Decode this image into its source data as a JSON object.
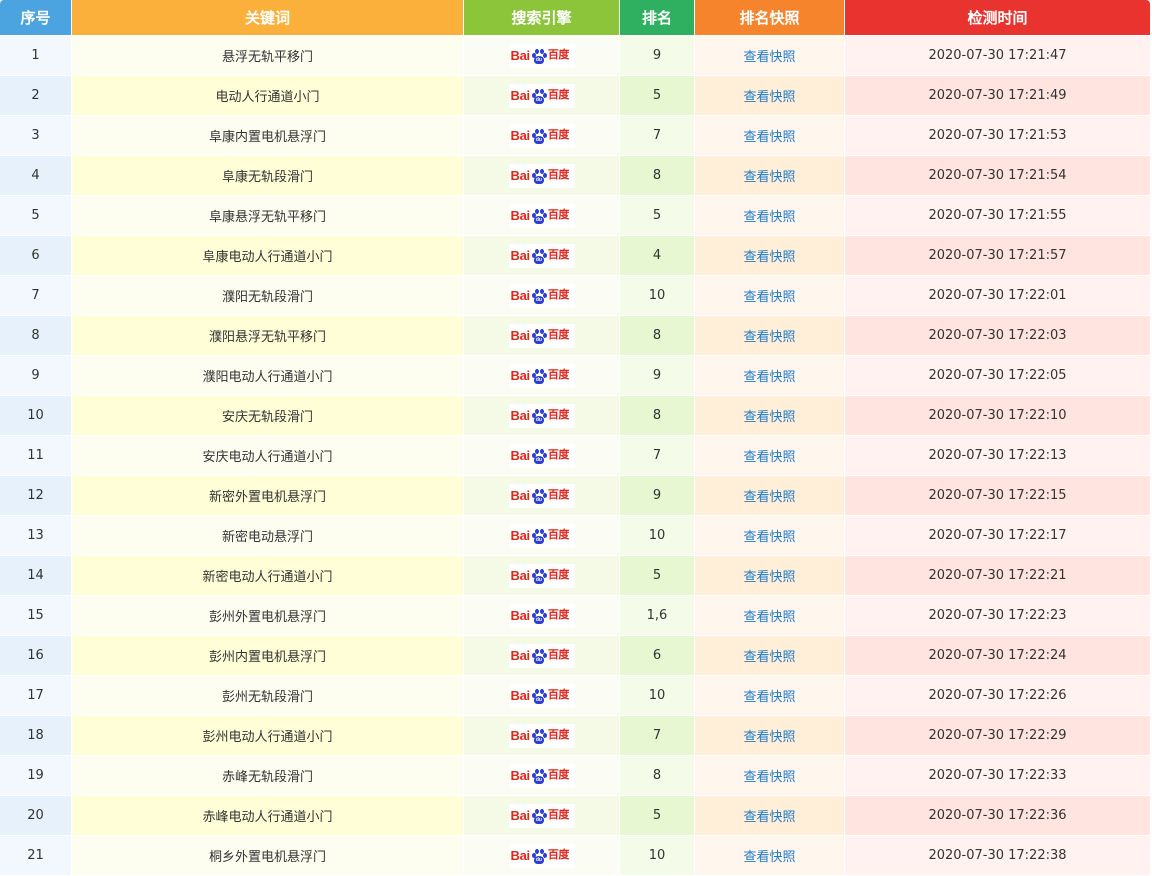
{
  "header": {
    "no": "序号",
    "keyword": "关键词",
    "engine": "搜索引擎",
    "rank": "排名",
    "snapshot": "排名快照",
    "time": "检测时间"
  },
  "engine_logo": {
    "latin": "Bai",
    "paw_text": "du",
    "chinese": "百度",
    "colors": {
      "text": "#e1251b",
      "paw": "#2b3fd1"
    }
  },
  "snapshot_label": "查看快照",
  "colors": {
    "header_no": "#4ba3e0",
    "header_keyword": "#fbb03b",
    "header_engine": "#8cc43a",
    "header_rank": "#2fb060",
    "header_snapshot": "#f5842c",
    "header_time": "#e8332f",
    "link": "#1e7bc7"
  },
  "rows": [
    {
      "no": "1",
      "keyword": "悬浮无轨平移门",
      "rank": "9",
      "time": "2020-07-30 17:21:47"
    },
    {
      "no": "2",
      "keyword": "电动人行通道小门",
      "rank": "5",
      "time": "2020-07-30 17:21:49"
    },
    {
      "no": "3",
      "keyword": "阜康内置电机悬浮门",
      "rank": "7",
      "time": "2020-07-30 17:21:53"
    },
    {
      "no": "4",
      "keyword": "阜康无轨段滑门",
      "rank": "8",
      "time": "2020-07-30 17:21:54"
    },
    {
      "no": "5",
      "keyword": "阜康悬浮无轨平移门",
      "rank": "5",
      "time": "2020-07-30 17:21:55"
    },
    {
      "no": "6",
      "keyword": "阜康电动人行通道小门",
      "rank": "4",
      "time": "2020-07-30 17:21:57"
    },
    {
      "no": "7",
      "keyword": "濮阳无轨段滑门",
      "rank": "10",
      "time": "2020-07-30 17:22:01"
    },
    {
      "no": "8",
      "keyword": "濮阳悬浮无轨平移门",
      "rank": "8",
      "time": "2020-07-30 17:22:03"
    },
    {
      "no": "9",
      "keyword": "濮阳电动人行通道小门",
      "rank": "9",
      "time": "2020-07-30 17:22:05"
    },
    {
      "no": "10",
      "keyword": "安庆无轨段滑门",
      "rank": "8",
      "time": "2020-07-30 17:22:10"
    },
    {
      "no": "11",
      "keyword": "安庆电动人行通道小门",
      "rank": "7",
      "time": "2020-07-30 17:22:13"
    },
    {
      "no": "12",
      "keyword": "新密外置电机悬浮门",
      "rank": "9",
      "time": "2020-07-30 17:22:15"
    },
    {
      "no": "13",
      "keyword": "新密电动悬浮门",
      "rank": "10",
      "time": "2020-07-30 17:22:17"
    },
    {
      "no": "14",
      "keyword": "新密电动人行通道小门",
      "rank": "5",
      "time": "2020-07-30 17:22:21"
    },
    {
      "no": "15",
      "keyword": "彭州外置电机悬浮门",
      "rank": "1,6",
      "time": "2020-07-30 17:22:23"
    },
    {
      "no": "16",
      "keyword": "彭州内置电机悬浮门",
      "rank": "6",
      "time": "2020-07-30 17:22:24"
    },
    {
      "no": "17",
      "keyword": "彭州无轨段滑门",
      "rank": "10",
      "time": "2020-07-30 17:22:26"
    },
    {
      "no": "18",
      "keyword": "彭州电动人行通道小门",
      "rank": "7",
      "time": "2020-07-30 17:22:29"
    },
    {
      "no": "19",
      "keyword": "赤峰无轨段滑门",
      "rank": "8",
      "time": "2020-07-30 17:22:33"
    },
    {
      "no": "20",
      "keyword": "赤峰电动人行通道小门",
      "rank": "5",
      "time": "2020-07-30 17:22:36"
    },
    {
      "no": "21",
      "keyword": "桐乡外置电机悬浮门",
      "rank": "10",
      "time": "2020-07-30 17:22:38"
    }
  ]
}
